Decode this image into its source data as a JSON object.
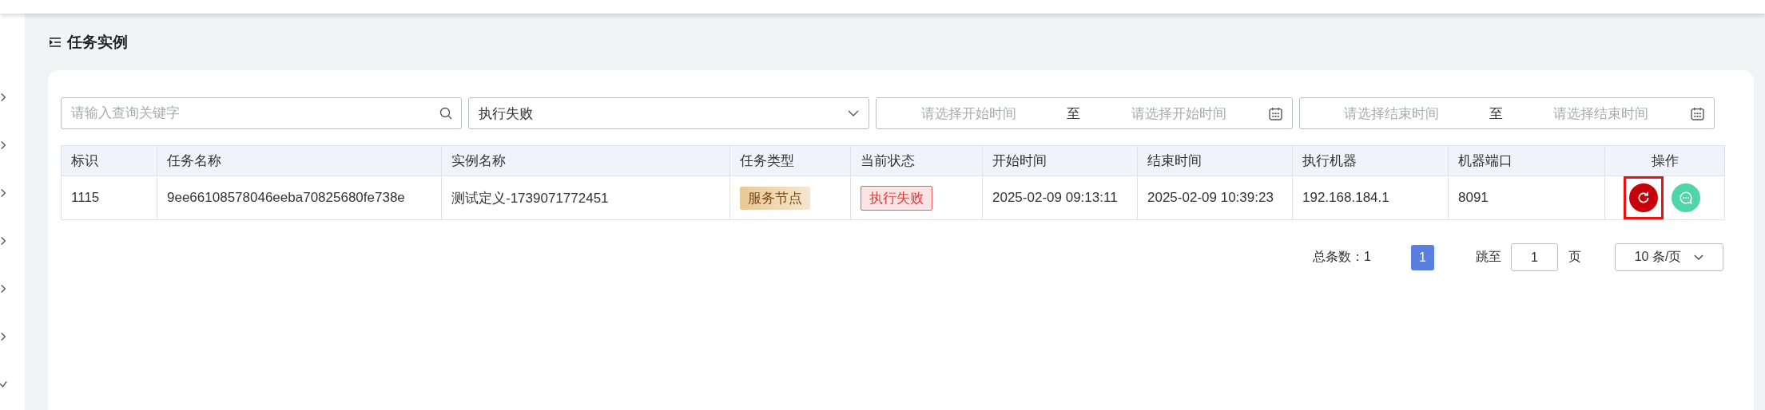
{
  "sidebar": {
    "items": [
      {
        "expanded": false
      },
      {
        "expanded": false
      },
      {
        "expanded": false
      },
      {
        "expanded": false
      },
      {
        "expanded": false
      },
      {
        "expanded": false
      },
      {
        "expanded": true
      }
    ]
  },
  "title": "任务实例",
  "filters": {
    "keyword": {
      "placeholder": "请输入查询关键字"
    },
    "status": {
      "value": "执行失败"
    },
    "ranges": [
      {
        "start_placeholder": "请选择开始时间",
        "separator": "至",
        "end_placeholder": "请选择开始时间"
      },
      {
        "start_placeholder": "请选择结束时间",
        "separator": "至",
        "end_placeholder": "请选择结束时间"
      }
    ]
  },
  "table": {
    "columns": [
      "标识",
      "任务名称",
      "实例名称",
      "任务类型",
      "当前状态",
      "开始时间",
      "结束时间",
      "执行机器",
      "机器端口",
      "操作"
    ],
    "rows": [
      {
        "cells": [
          {
            "kind": "text",
            "text": "1115"
          },
          {
            "kind": "text",
            "text": "9ee66108578046eeba70825680fe738e"
          },
          {
            "kind": "text",
            "text": "测试定义-1739071772451"
          },
          {
            "kind": "type-tag",
            "text": "服务节点"
          },
          {
            "kind": "status-tag",
            "text": "执行失败"
          },
          {
            "kind": "text",
            "text": "2025-02-09 09:13:11"
          },
          {
            "kind": "text",
            "text": "2025-02-09 10:39:23"
          },
          {
            "kind": "text",
            "text": "192.168.184.1"
          },
          {
            "kind": "text",
            "text": "8091"
          },
          {
            "kind": "actions",
            "actions": [
              {
                "kind": "retry",
                "highlighted": true
              },
              {
                "kind": "log",
                "highlighted": false
              }
            ]
          }
        ]
      }
    ]
  },
  "pagination": {
    "total": "总条数：1",
    "pages": [
      {
        "label": "1",
        "selected": true
      }
    ],
    "jump_label": "跳至",
    "jump_value": "1",
    "page_unit": "页",
    "page_size": "10 条/页"
  }
}
